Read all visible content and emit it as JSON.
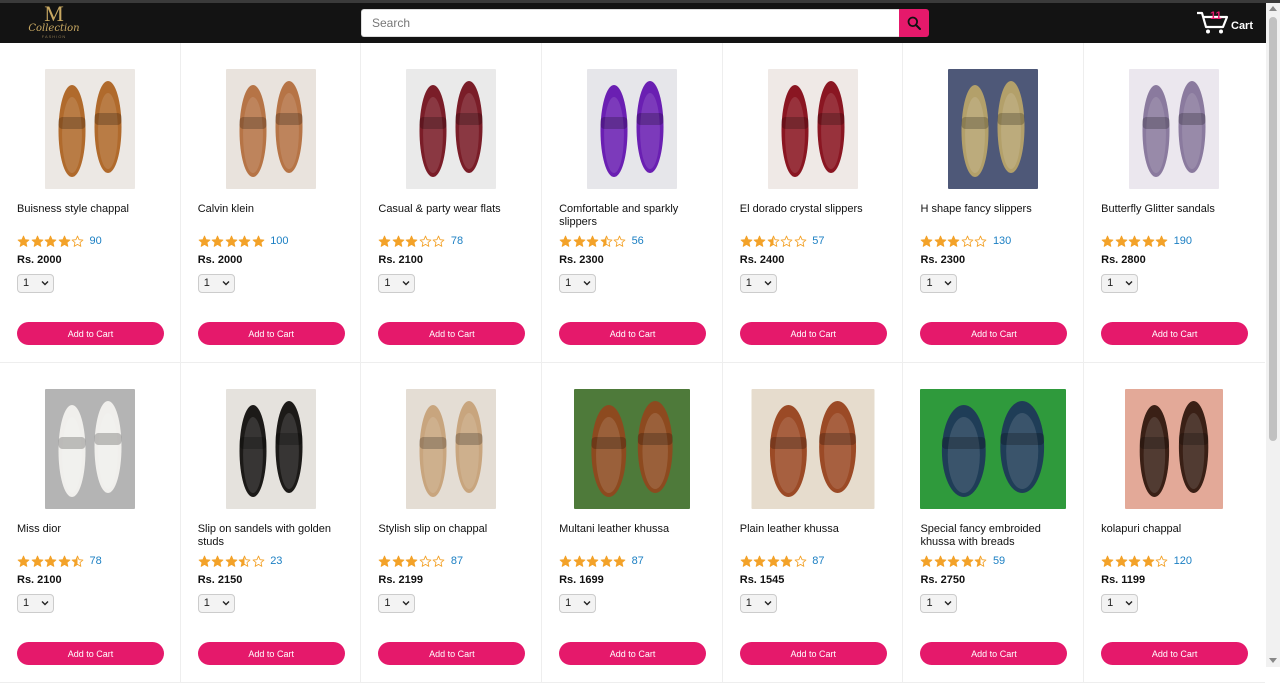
{
  "brand": {
    "logo_letter": "M",
    "logo_script": "Collection",
    "logo_tagline": "FASHION"
  },
  "search": {
    "placeholder": "Search",
    "value": ""
  },
  "cart": {
    "count": "11",
    "label": "Cart"
  },
  "colors": {
    "accent": "#e5196b",
    "header": "#131313",
    "star": "#f3a229",
    "link": "#1b7fc3"
  },
  "products": [
    {
      "name": "Buisness style chappal",
      "rating": 4,
      "rating_count": "90",
      "price": "Rs. 2000",
      "qty": "1",
      "button": "Add to Cart",
      "image_icon": "brown-flat-sandal",
      "img_color": "#b06a2c",
      "img_bg": "#ece8e4"
    },
    {
      "name": "Calvin klein",
      "rating": 5,
      "rating_count": "100",
      "price": "Rs. 2000",
      "qty": "1",
      "button": "Add to Cart",
      "image_icon": "tan-strap-sandal",
      "img_color": "#b67446",
      "img_bg": "#e9e3dd"
    },
    {
      "name": "Casual & party wear flats",
      "rating": 3,
      "rating_count": "78",
      "price": "Rs. 2100",
      "qty": "1",
      "button": "Add to Cart",
      "image_icon": "maroon-flat",
      "img_color": "#7a1d28",
      "img_bg": "#eaeaea"
    },
    {
      "name": "Comfortable and sparkly slippers",
      "rating": 3.5,
      "rating_count": "56",
      "price": "Rs. 2300",
      "qty": "1",
      "button": "Add to Cart",
      "image_icon": "purple-sparkly-slipper",
      "img_color": "#6a1fb2",
      "img_bg": "#e6e6ea"
    },
    {
      "name": "El dorado crystal slippers",
      "rating": 2.5,
      "rating_count": "57",
      "price": "Rs. 2400",
      "qty": "1",
      "button": "Add to Cart",
      "image_icon": "maroon-crystal-slipper",
      "img_color": "#8a1622",
      "img_bg": "#efe9e6"
    },
    {
      "name": "H shape fancy slippers",
      "rating": 3,
      "rating_count": "130",
      "price": "Rs. 2300",
      "qty": "1",
      "button": "Add to Cart",
      "image_icon": "gold-h-slipper",
      "img_color": "#b3a06a",
      "img_bg": "#4e5878"
    },
    {
      "name": "Butterfly Glitter sandals",
      "rating": 5,
      "rating_count": "190",
      "price": "Rs. 2800",
      "qty": "1",
      "button": "Add to Cart",
      "image_icon": "lilac-butterfly-sandal",
      "img_color": "#8a7a9e",
      "img_bg": "#ebe7ee"
    },
    {
      "name": "Miss dior",
      "rating": 4.5,
      "rating_count": "78",
      "price": "Rs. 2100",
      "qty": "1",
      "button": "Add to Cart",
      "image_icon": "white-dior-slide",
      "img_color": "#f0efec",
      "img_bg": "#b4b4b4"
    },
    {
      "name": "Slip on sandels with golden studs",
      "rating": 3.5,
      "rating_count": "23",
      "price": "Rs. 2150",
      "qty": "1",
      "button": "Add to Cart",
      "image_icon": "black-studded-sandal",
      "img_color": "#1c1a18",
      "img_bg": "#e5e2dd"
    },
    {
      "name": "Stylish slip on chappal",
      "rating": 3,
      "rating_count": "87",
      "price": "Rs. 2199",
      "qty": "1",
      "button": "Add to Cart",
      "image_icon": "beige-braided-chappal",
      "img_color": "#c8a57e",
      "img_bg": "#e4ddd4"
    },
    {
      "name": "Multani leather khussa",
      "rating": 5,
      "rating_count": "87",
      "price": "Rs. 1699",
      "qty": "1",
      "button": "Add to Cart",
      "image_icon": "brown-leather-khussa",
      "img_color": "#8d4a1f",
      "img_bg": "#4e7a3a"
    },
    {
      "name": "Plain leather khussa",
      "rating": 4,
      "rating_count": "87",
      "price": "Rs. 1545",
      "qty": "1",
      "button": "Add to Cart",
      "image_icon": "plain-leather-khussa",
      "img_color": "#9b4a26",
      "img_bg": "#e6dccd"
    },
    {
      "name": "Special fancy embroided khussa with breads",
      "rating": 4.5,
      "rating_count": "59",
      "price": "Rs. 2750",
      "qty": "1",
      "button": "Add to Cart",
      "image_icon": "embroidered-khussa",
      "img_color": "#1f3d57",
      "img_bg": "#2f9a3c"
    },
    {
      "name": "kolapuri chappal",
      "rating": 4,
      "rating_count": "120",
      "price": "Rs. 1199",
      "qty": "1",
      "button": "Add to Cart",
      "image_icon": "kolapuri-chappal",
      "img_color": "#3a2016",
      "img_bg": "#e3a998"
    }
  ]
}
